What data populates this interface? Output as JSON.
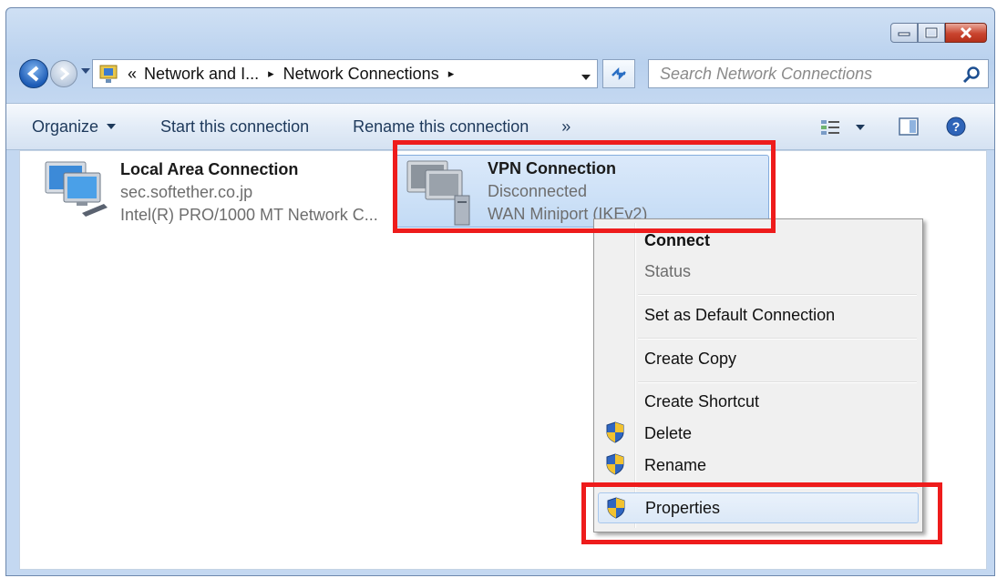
{
  "window": {
    "breadcrumb": {
      "prefix": "«",
      "segment1": "Network and I...",
      "sep1": "▸",
      "segment2": "Network Connections",
      "sep2": "▸"
    },
    "search": {
      "placeholder": "Search Network Connections"
    },
    "buttons": {
      "minimize": "minimize",
      "maximize": "maximize",
      "close": "close"
    }
  },
  "toolbar": {
    "organize": "Organize",
    "start": "Start this connection",
    "rename": "Rename this connection",
    "more": "»"
  },
  "connections": [
    {
      "name": "Local Area Connection",
      "status": "sec.softether.co.jp",
      "device": "Intel(R) PRO/1000 MT Network C..."
    },
    {
      "name": "VPN Connection",
      "status": "Disconnected",
      "device": "WAN Miniport (IKEv2)"
    }
  ],
  "context_menu": {
    "items": [
      {
        "label": "Connect",
        "bold": true
      },
      {
        "label": "Status",
        "disabled": true
      },
      {
        "label": "Set as Default Connection"
      },
      {
        "label": "Create Copy"
      },
      {
        "label": "Create Shortcut"
      },
      {
        "label": "Delete",
        "shield": true
      },
      {
        "label": "Rename",
        "shield": true
      },
      {
        "label": "Properties",
        "shield": true,
        "highlighted": true
      }
    ]
  },
  "colors": {
    "highlight_box": "#ee1c1c",
    "selection": "#c3dbf5",
    "toolbar_text": "#1e395b"
  }
}
